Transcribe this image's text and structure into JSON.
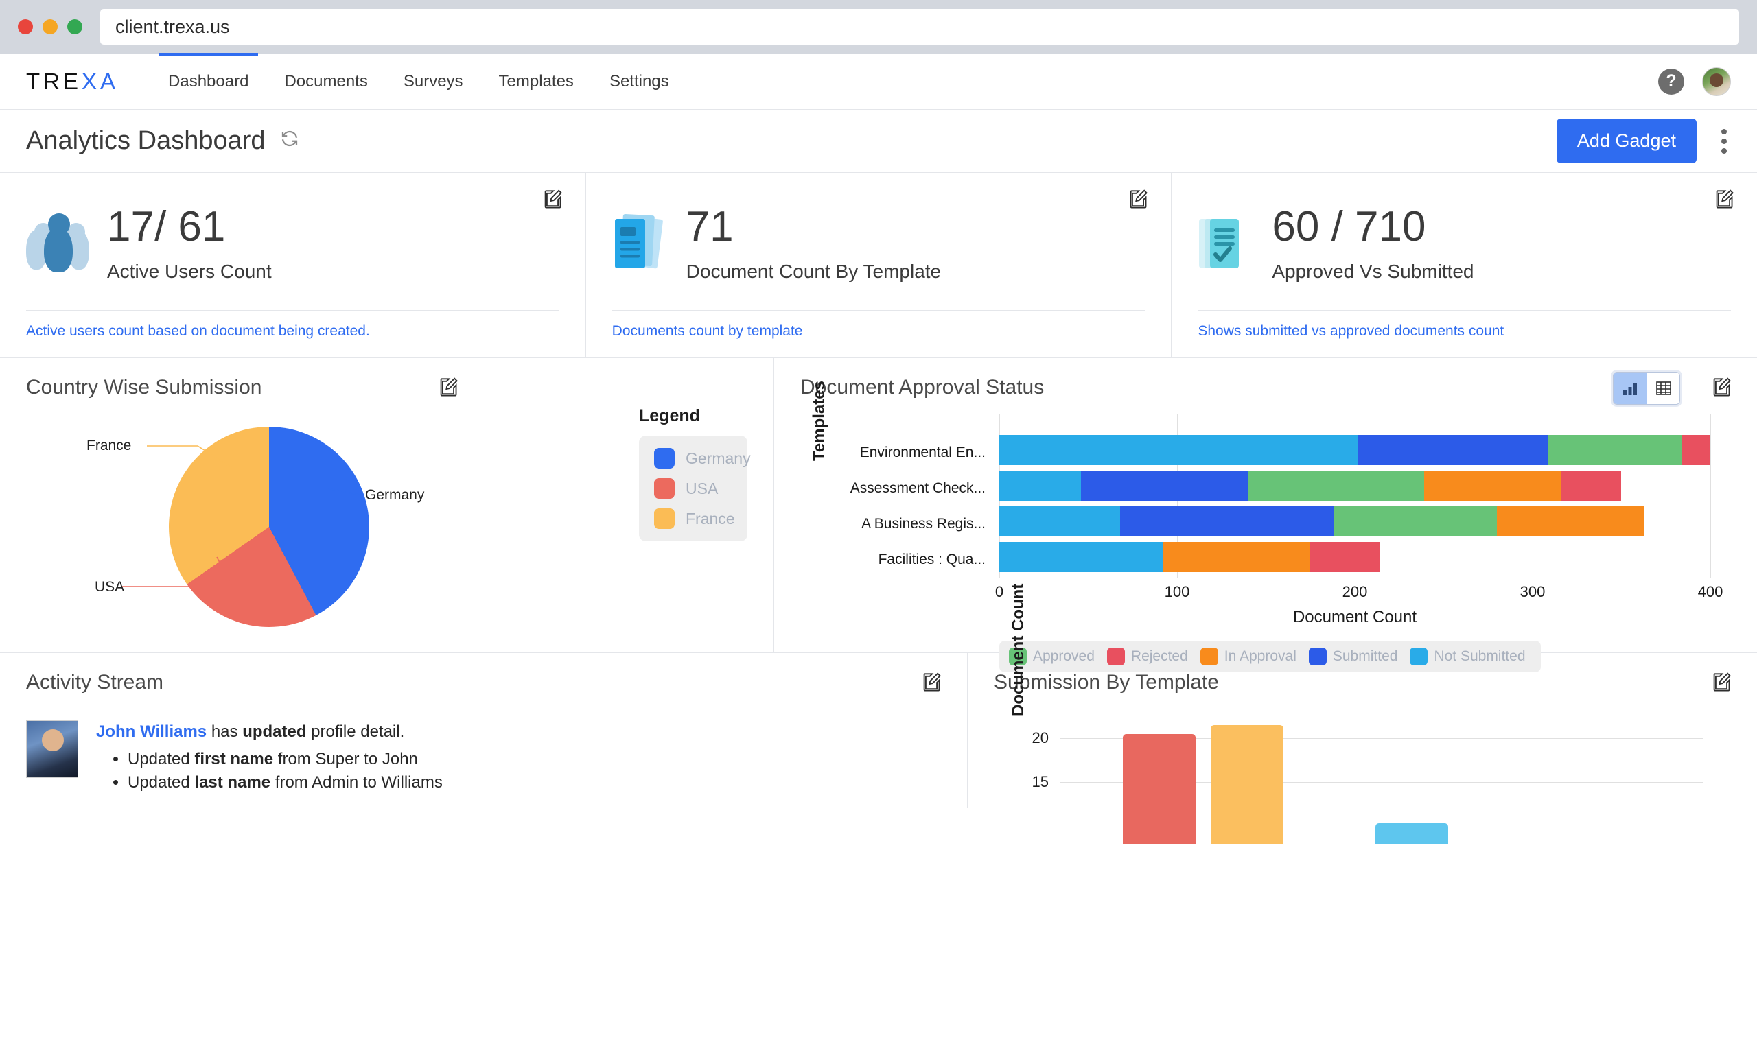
{
  "browser": {
    "url": "client.trexa.us"
  },
  "nav": {
    "logo_dark": "TRE",
    "logo_blue": "XA",
    "items": [
      {
        "label": "Dashboard",
        "active": true
      },
      {
        "label": "Documents",
        "active": false
      },
      {
        "label": "Surveys",
        "active": false
      },
      {
        "label": "Templates",
        "active": false
      },
      {
        "label": "Settings",
        "active": false
      }
    ],
    "help_glyph": "?"
  },
  "header": {
    "title": "Analytics Dashboard",
    "refresh_icon": "refresh-icon",
    "add_gadget_label": "Add Gadget",
    "more_menu_icon": "kebab-menu-icon",
    "accent_color": "#2f6cf0"
  },
  "kpis": [
    {
      "icon": "users-icon",
      "value": "17/ 61",
      "label": "Active Users Count",
      "footnote": "Active users count based on document being created.",
      "edit_icon": "edit-icon"
    },
    {
      "icon": "documents-icon",
      "value": "71",
      "label": "Document Count By Template",
      "footnote": "Documents count by template",
      "edit_icon": "edit-icon"
    },
    {
      "icon": "approved-document-icon",
      "value": "60 / 710",
      "label": "Approved Vs Submitted",
      "footnote": "Shows submitted vs approved documents count",
      "edit_icon": "edit-icon"
    }
  ],
  "country_widget": {
    "title": "Country Wise Submission",
    "edit_icon": "edit-icon",
    "legend_title": "Legend",
    "callouts": [
      "France",
      "USA",
      "Germany"
    ]
  },
  "approval_widget": {
    "title": "Document Approval Status",
    "edit_icon": "edit-icon",
    "toggle_chart_icon": "bar-chart-icon",
    "toggle_table_icon": "table-grid-icon",
    "toggle_selected": "chart"
  },
  "activity_widget": {
    "title": "Activity Stream",
    "edit_icon": "edit-icon",
    "entry": {
      "user": "John Williams",
      "action_pre": " has ",
      "action_bold": "updated",
      "action_post": " profile detail.",
      "bullets": [
        {
          "pre": "Updated ",
          "bold": "first name",
          "post": " from Super to John"
        },
        {
          "pre": "Updated ",
          "bold": "last name",
          "post": " from Admin to Williams"
        }
      ]
    }
  },
  "submission_widget": {
    "title": "Submission By Template",
    "edit_icon": "edit-icon"
  },
  "chart_data": [
    {
      "type": "pie",
      "title": "Country Wise Submission",
      "labels": [
        "Germany",
        "USA",
        "France"
      ],
      "values": [
        42,
        23,
        35
      ],
      "colors": [
        "#2f6cf0",
        "#ec6a5e",
        "#fbbc55"
      ],
      "legend_position": "right",
      "legend_title": "Legend"
    },
    {
      "type": "bar",
      "orientation": "horizontal",
      "stacked": true,
      "title": "Document Approval Status",
      "xlabel": "Document Count",
      "ylabel": "Templates",
      "xlim": [
        0,
        400
      ],
      "xticks": [
        0,
        100,
        200,
        300,
        400
      ],
      "grid": true,
      "categories": [
        "Environmental En...",
        "Assessment Check...",
        "A Business Regis...",
        "Facilities : Qua..."
      ],
      "series": [
        {
          "name": "Not Submitted",
          "color": "#29abe8",
          "values": [
            202,
            46,
            68,
            92
          ]
        },
        {
          "name": "Submitted",
          "color": "#2c5be8",
          "values": [
            107,
            94,
            120,
            0
          ]
        },
        {
          "name": "Approved",
          "color": "#67c377",
          "values": [
            75,
            99,
            92,
            0
          ]
        },
        {
          "name": "In Approval",
          "color": "#f88b1c",
          "values": [
            0,
            77,
            83,
            83
          ]
        },
        {
          "name": "Rejected",
          "color": "#e8505f",
          "values": [
            16,
            34,
            0,
            39
          ]
        }
      ],
      "legend_order": [
        "Approved",
        "Rejected",
        "In Approval",
        "Submitted",
        "Not Submitted"
      ],
      "legend_position": "bottom"
    },
    {
      "type": "bar",
      "orientation": "vertical",
      "title": "Submission By Template",
      "ylabel": "Document Count",
      "yticks": [
        15,
        20
      ],
      "grid": true,
      "bars": [
        {
          "value": 20,
          "color": "#e8685f"
        },
        {
          "value": 21,
          "color": "#fbbf5f"
        },
        {
          "value": 12,
          "color": "#5ec6ee"
        }
      ]
    }
  ]
}
